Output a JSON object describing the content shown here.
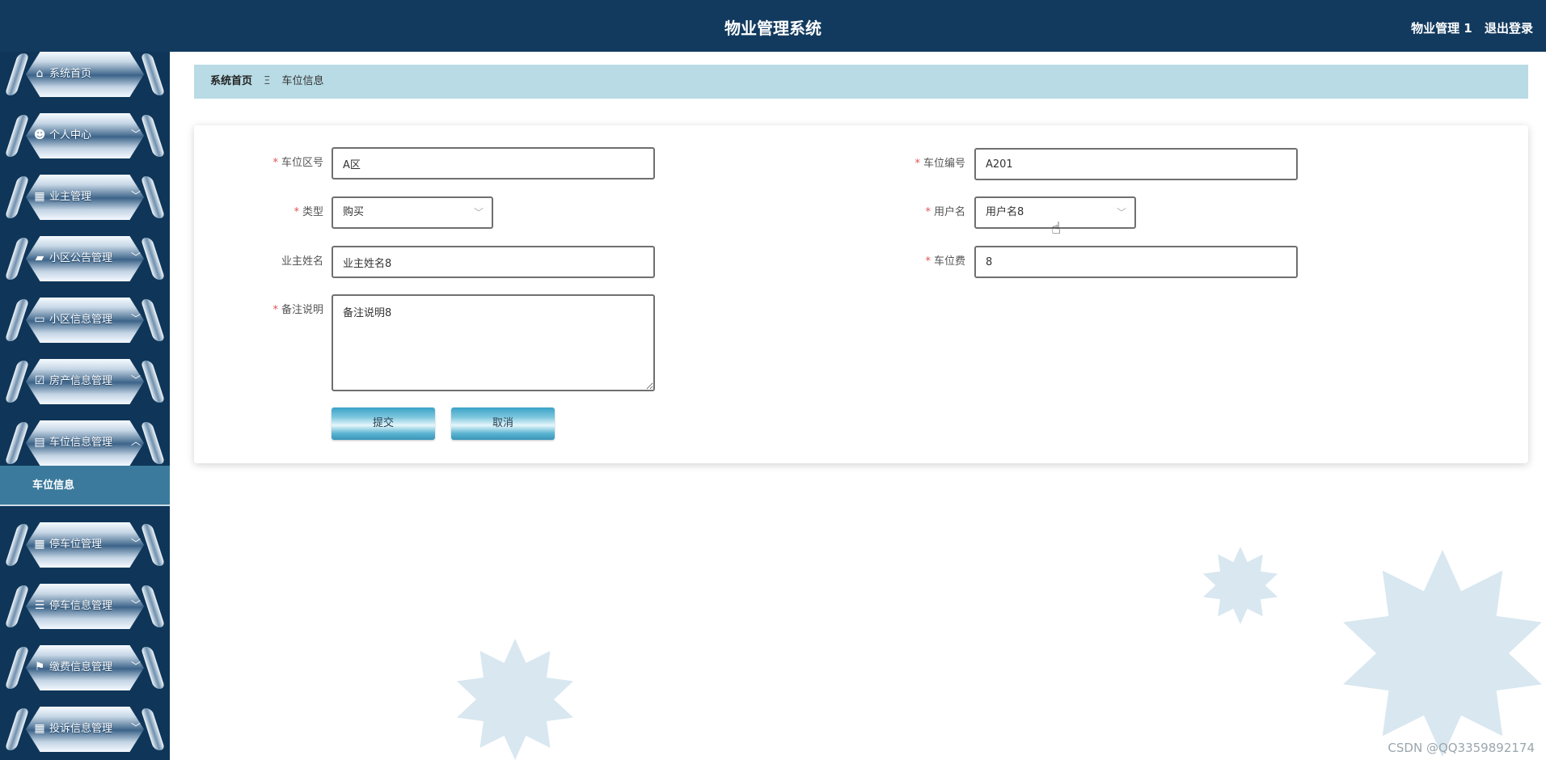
{
  "header": {
    "title": "物业管理系统",
    "username": "物业管理 1",
    "logout_label": "退出登录"
  },
  "sidebar": {
    "items": [
      {
        "label": "系统首页",
        "icon": "home-icon",
        "glyph": "⌂",
        "chevron": ""
      },
      {
        "label": "个人中心",
        "icon": "user-icon",
        "glyph": "☻",
        "chevron": "﹀"
      },
      {
        "label": "业主管理",
        "icon": "grid-icon",
        "glyph": "▦",
        "chevron": "﹀"
      },
      {
        "label": "小区公告管理",
        "icon": "briefcase-icon",
        "glyph": "▰",
        "chevron": "﹀"
      },
      {
        "label": "小区信息管理",
        "icon": "monitor-icon",
        "glyph": "▭",
        "chevron": "﹀"
      },
      {
        "label": "房产信息管理",
        "icon": "clipboard-check-icon",
        "glyph": "☑",
        "chevron": "﹀"
      },
      {
        "label": "车位信息管理",
        "icon": "clipboard-icon",
        "glyph": "▤",
        "chevron": "︿"
      },
      {
        "label": "停车位管理",
        "icon": "grid-icon",
        "glyph": "▦",
        "chevron": "﹀"
      },
      {
        "label": "停车信息管理",
        "icon": "list-icon",
        "glyph": "☰",
        "chevron": "﹀"
      },
      {
        "label": "缴费信息管理",
        "icon": "flag-icon",
        "glyph": "⚑",
        "chevron": "﹀"
      },
      {
        "label": "投诉信息管理",
        "icon": "grid-icon",
        "glyph": "▦",
        "chevron": "﹀"
      }
    ],
    "active_submenu": "车位信息"
  },
  "breadcrumb": {
    "home": "系统首页",
    "separator": "Ξ",
    "current": "车位信息"
  },
  "form": {
    "area_label": "车位区号",
    "area_value": "A区",
    "number_label": "车位编号",
    "number_value": "A201",
    "type_label": "类型",
    "type_value": "购买",
    "username_label": "用户名",
    "username_value": "用户名8",
    "owner_label": "业主姓名",
    "owner_value": "业主姓名8",
    "fee_label": "车位费",
    "fee_value": "8",
    "note_label": "备注说明",
    "note_value": "备注说明8",
    "submit_label": "提交",
    "cancel_label": "取消",
    "required_mark": "*"
  },
  "watermark": "CSDN @QQ3359892174",
  "colors": {
    "topbar": "#123a5e",
    "sidebar": "#0f3659",
    "breadcrumb_bg": "#b8dbe5",
    "submenu_active": "#3b7a9c",
    "required": "#e25454"
  }
}
